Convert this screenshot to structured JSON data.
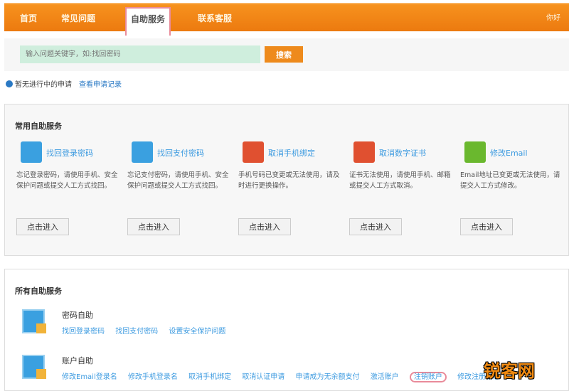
{
  "nav": {
    "items": [
      "首页",
      "常见问题",
      "自助服务",
      "联系客服"
    ],
    "active": 2,
    "right": "你好"
  },
  "search": {
    "placeholder": "输入问题关键字，如:找回密码",
    "button": "搜索"
  },
  "status": {
    "text": "暂无进行中的申请",
    "link": "查看申请记录"
  },
  "common": {
    "title": "常用自助服务",
    "cards": [
      {
        "title": "找回登录密码",
        "desc": "忘记登录密码，请使用手机、安全保护问题或提交人工方式找回。",
        "button": "点击进入",
        "icon": "key-icon",
        "color": "#3aa0e0"
      },
      {
        "title": "找回支付密码",
        "desc": "忘记支付密码，请使用手机、安全保护问题或提交人工方式找回。",
        "button": "点击进入",
        "icon": "key-icon",
        "color": "#3aa0e0"
      },
      {
        "title": "取消手机绑定",
        "desc": "手机号码已变更或无法使用，请及时进行更换操作。",
        "button": "点击进入",
        "icon": "phone-x-icon",
        "color": "#e05030"
      },
      {
        "title": "取消数字证书",
        "desc": "证书无法使用，请使用手机、邮箱或提交人工方式取消。",
        "button": "点击进入",
        "icon": "cert-x-icon",
        "color": "#e05030"
      },
      {
        "title": "修改Email",
        "desc": "Email地址已变更或无法使用，请提交人工方式修改。",
        "button": "点击进入",
        "icon": "email-icon",
        "color": "#6ab82e"
      }
    ]
  },
  "all": {
    "title": "所有自助服务",
    "groups": [
      {
        "title": "密码自助",
        "links": [
          "找回登录密码",
          "找回支付密码",
          "设置安全保护问题"
        ]
      },
      {
        "title": "账户自助",
        "links": [
          "修改Email登录名",
          "修改手机登录名",
          "取消手机绑定",
          "取消认证申请",
          "申请成为无余额支付",
          "激活账户",
          "注销账户",
          "修改注册信息"
        ],
        "circled": 6
      }
    ]
  },
  "watermark": "锐客网"
}
